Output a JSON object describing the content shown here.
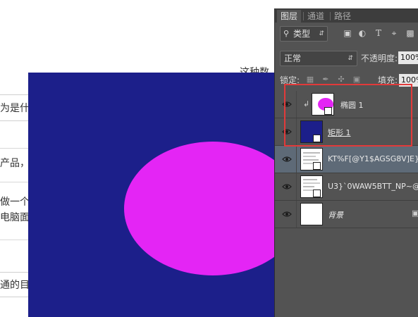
{
  "background_text": {
    "heading_fragment": "这种数",
    "fragment_1": "为是什",
    "fragment_2": "产品，",
    "fragment_3": "做一个",
    "fragment_4": "电脑面",
    "fragment_5": "通的目"
  },
  "canvas": {
    "background_color": "#1c1f8a",
    "ellipse_color": "#e425f5"
  },
  "layers_panel": {
    "tabs": [
      {
        "label": "图层",
        "active": true
      },
      {
        "label": "通道",
        "active": false
      },
      {
        "label": "路径",
        "active": false
      }
    ],
    "filter": {
      "icon": "search-icon",
      "label": "类型"
    },
    "filter_icons": [
      "image-filter-icon",
      "adjustment-filter-icon",
      "type-filter-icon",
      "shape-filter-icon",
      "smart-object-filter-icon"
    ],
    "blend_mode": "正常",
    "opacity_label": "不透明度:",
    "opacity_value": "100%",
    "lock_label": "锁定:",
    "fill_label": "填充:",
    "fill_value": "100%",
    "layers": [
      {
        "name": "椭圆 1",
        "clipped": true,
        "selected": false
      },
      {
        "name": "矩形 1",
        "clipped": false,
        "selected": false
      },
      {
        "name": "KT%F[@Y1$AGSG8V]E}...",
        "clipped": false,
        "selected": true
      },
      {
        "name": "U3}`0WAW5BTT_NP~@...",
        "clipped": false,
        "selected": false
      },
      {
        "name": "背景",
        "clipped": false,
        "selected": false
      }
    ]
  },
  "highlight_color": "#e23a3a"
}
